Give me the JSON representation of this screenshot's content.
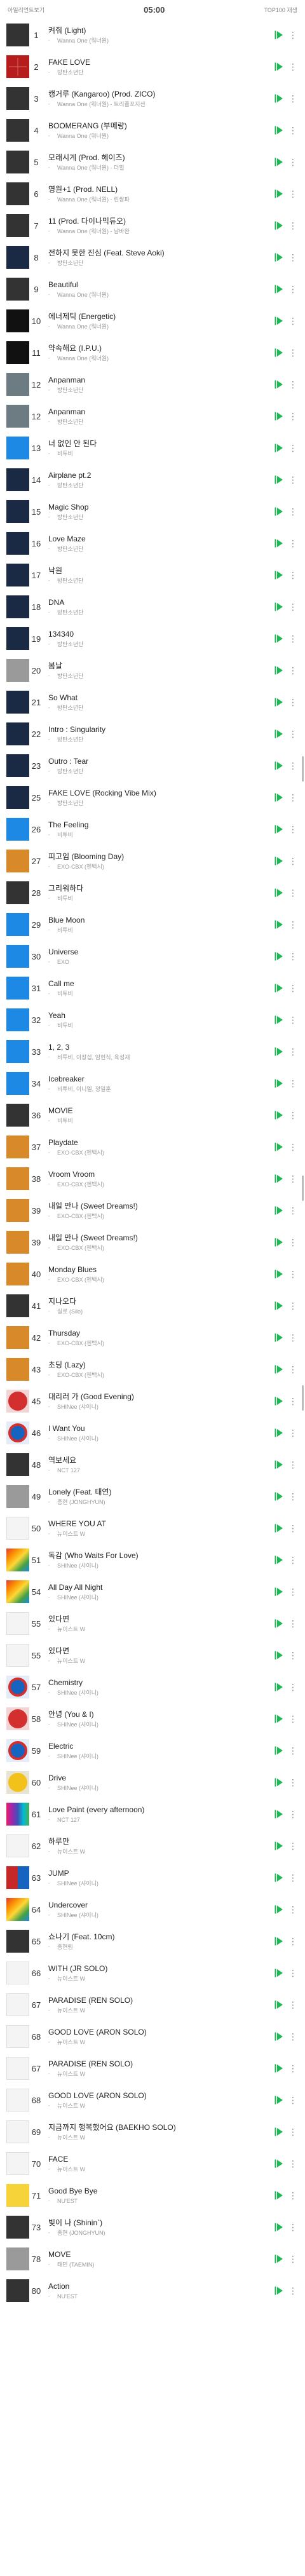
{
  "status": {
    "left": "아일리언트보기",
    "time": "05:00",
    "right": "TOP100 재생"
  },
  "colors": {
    "accent": "#1db954",
    "change": "#9ccc3c"
  },
  "icons": {
    "play": "play-icon",
    "more": "more-vertical-icon"
  },
  "songs": [
    {
      "rank": "1",
      "title": "켜줘 (Light)",
      "artist": "Wanna One (워너원)",
      "change": "-",
      "art": "dark"
    },
    {
      "rank": "2",
      "title": "FAKE LOVE",
      "artist": "방탄소년단",
      "change": "-",
      "art": "grid-red"
    },
    {
      "rank": "3",
      "title": "캥거루 (Kangaroo) (Prod. ZICO)",
      "artist": "Wanna One (워너원) - 트리플포지션",
      "change": "-",
      "art": "dark"
    },
    {
      "rank": "4",
      "title": "BOOMERANG (부메랑)",
      "artist": "Wanna One (워너원)",
      "change": "-",
      "art": "dark"
    },
    {
      "rank": "5",
      "title": "모래시계 (Prod. 헤이즈)",
      "artist": "Wanna One (워너원) - 더힐",
      "change": "-",
      "art": "dark"
    },
    {
      "rank": "6",
      "title": "영원+1 (Prod. NELL)",
      "artist": "Wanna One (워너원) - 린쌍파",
      "change": "-",
      "art": "dark"
    },
    {
      "rank": "7",
      "title": "11 (Prod. 다이나믹듀오)",
      "artist": "Wanna One (워너원) - 남바완",
      "change": "-",
      "art": "dark"
    },
    {
      "rank": "8",
      "title": "전하지 못한 진심 (Feat. Steve Aoki)",
      "artist": "방탄소년단",
      "change": "-",
      "art": "navy"
    },
    {
      "rank": "9",
      "title": "Beautiful",
      "artist": "Wanna One (워너원)",
      "change": "-",
      "art": "dark"
    },
    {
      "rank": "10",
      "title": "에너제틱 (Energetic)",
      "artist": "Wanna One (워너원)",
      "change": "-",
      "art": "black"
    },
    {
      "rank": "11",
      "title": "약속해요 (I.P.U.)",
      "artist": "Wanna One (워너원)",
      "change": "-",
      "art": "black"
    },
    {
      "rank": "12",
      "title": "Anpanman",
      "artist": "방탄소년단",
      "change": "-",
      "art": "sea"
    },
    {
      "rank": "12",
      "title": "Anpanman",
      "artist": "방탄소년단",
      "change": "-",
      "art": "sea"
    },
    {
      "rank": "13",
      "title": "너 없인 안 된다",
      "artist": "비투비",
      "change": "-",
      "art": "blue"
    },
    {
      "rank": "14",
      "title": "Airplane pt.2",
      "artist": "방탄소년단",
      "change": "-",
      "art": "navy"
    },
    {
      "rank": "15",
      "title": "Magic Shop",
      "artist": "방탄소년단",
      "change": "-",
      "art": "navy"
    },
    {
      "rank": "16",
      "title": "Love Maze",
      "artist": "방탄소년단",
      "change": "-",
      "art": "navy"
    },
    {
      "rank": "17",
      "title": "낙원",
      "artist": "방탄소년단",
      "change": "-",
      "art": "navy"
    },
    {
      "rank": "18",
      "title": "DNA",
      "artist": "방탄소년단",
      "change": "-",
      "art": "navy"
    },
    {
      "rank": "19",
      "title": "134340",
      "artist": "방탄소년단",
      "change": "-",
      "art": "navy"
    },
    {
      "rank": "20",
      "title": "봄날",
      "artist": "방탄소년단",
      "change": "-",
      "art": "gray"
    },
    {
      "rank": "21",
      "title": "So What",
      "artist": "방탄소년단",
      "change": "-",
      "art": "navy"
    },
    {
      "rank": "22",
      "title": "Intro : Singularity",
      "artist": "방탄소년단",
      "change": "-",
      "art": "navy"
    },
    {
      "rank": "23",
      "title": "Outro : Tear",
      "artist": "방탄소년단",
      "change": "-",
      "art": "navy"
    },
    {
      "rank": "25",
      "title": "FAKE LOVE (Rocking Vibe Mix)",
      "artist": "방탄소년단",
      "change": "-",
      "art": "navy"
    },
    {
      "rank": "26",
      "title": "The Feeling",
      "artist": "비투비",
      "change": "-",
      "art": "blue"
    },
    {
      "rank": "27",
      "title": "피고임 (Blooming Day)",
      "artist": "EXO-CBX (첸백시)",
      "change": "-",
      "art": "orange"
    },
    {
      "rank": "28",
      "title": "그리워하다",
      "artist": "비투비",
      "change": "-",
      "art": "dark"
    },
    {
      "rank": "29",
      "title": "Blue Moon",
      "artist": "비투비",
      "change": "-",
      "art": "blue"
    },
    {
      "rank": "30",
      "title": "Universe",
      "artist": "EXO",
      "change": "-",
      "art": "blue"
    },
    {
      "rank": "31",
      "title": "Call me",
      "artist": "비투비",
      "change": "-",
      "art": "blue"
    },
    {
      "rank": "32",
      "title": "Yeah",
      "artist": "비투비",
      "change": "-",
      "art": "blue"
    },
    {
      "rank": "33",
      "title": "1, 2, 3",
      "artist": "비투비, 이창섭, 임현식, 육성재",
      "change": "-",
      "art": "blue"
    },
    {
      "rank": "34",
      "title": "Icebreaker",
      "artist": "비투비, 이니엘, 정일훈",
      "change": "-",
      "art": "blue"
    },
    {
      "rank": "36",
      "title": "MOVIE",
      "artist": "비투비",
      "change": "-",
      "art": "dark"
    },
    {
      "rank": "37",
      "title": "Playdate",
      "artist": "EXO-CBX (첸백시)",
      "change": "-",
      "art": "orange"
    },
    {
      "rank": "38",
      "title": "Vroom Vroom",
      "artist": "EXO-CBX (첸백시)",
      "change": "-",
      "art": "orange"
    },
    {
      "rank": "39",
      "title": "내일 만나 (Sweet Dreams!)",
      "artist": "EXO-CBX (첸백시)",
      "change": "-",
      "art": "orange"
    },
    {
      "rank": "39",
      "title": "내일 만나 (Sweet Dreams!)",
      "artist": "EXO-CBX (첸백시)",
      "change": "-",
      "art": "orange"
    },
    {
      "rank": "40",
      "title": "Monday Blues",
      "artist": "EXO-CBX (첸백시)",
      "change": "-",
      "art": "orange"
    },
    {
      "rank": "41",
      "title": "지나오다",
      "artist": "실로 (Silo)",
      "change": "-",
      "art": "dark"
    },
    {
      "rank": "42",
      "title": "Thursday",
      "artist": "EXO-CBX (첸백시)",
      "change": "-",
      "art": "orange"
    },
    {
      "rank": "43",
      "title": "초딩 (Lazy)",
      "artist": "EXO-CBX (첸백시)",
      "change": "-",
      "art": "orange"
    },
    {
      "rank": "45",
      "title": "대리러 가 (Good Evening)",
      "artist": "SHINee (샤이니)",
      "change": "-",
      "art": "circle-red"
    },
    {
      "rank": "46",
      "title": "I Want You",
      "artist": "SHINee (샤이니)",
      "change": "-",
      "art": "circle-blue"
    },
    {
      "rank": "48",
      "title": "역보세요",
      "artist": "NCT 127",
      "change": "-",
      "art": "dark"
    },
    {
      "rank": "49",
      "title": "Lonely (Feat. 태연)",
      "artist": "종현 (JONGHYUN)",
      "change": "-",
      "art": "gray"
    },
    {
      "rank": "50",
      "title": "WHERE YOU AT",
      "artist": "뉴이스트 W",
      "change": "-",
      "art": "white"
    },
    {
      "rank": "51",
      "title": "독감 (Who Waits For Love)",
      "artist": "SHINee (샤이니)",
      "change": "-",
      "art": "colorful"
    },
    {
      "rank": "54",
      "title": "All Day All Night",
      "artist": "SHINee (샤이니)",
      "change": "-",
      "art": "colorful"
    },
    {
      "rank": "55",
      "title": "있다면",
      "artist": "뉴이스트 W",
      "change": "-",
      "art": "white"
    },
    {
      "rank": "55",
      "title": "있다면",
      "artist": "뉴이스트 W",
      "change": "-",
      "art": "white"
    },
    {
      "rank": "57",
      "title": "Chemistry",
      "artist": "SHINee (샤이니)",
      "change": "-",
      "art": "circle-blue"
    },
    {
      "rank": "58",
      "title": "안녕 (You & I)",
      "artist": "SHINee (샤이니)",
      "change": "-",
      "art": "circle-red"
    },
    {
      "rank": "59",
      "title": "Electric",
      "artist": "SHINee (샤이니)",
      "change": "-",
      "art": "circle-blue"
    },
    {
      "rank": "60",
      "title": "Drive",
      "artist": "SHINee (샤이니)",
      "change": "-",
      "art": "circle-yellow"
    },
    {
      "rank": "61",
      "title": "Love Paint (every afternoon)",
      "artist": "NCT 127",
      "change": "-",
      "art": "rainbow"
    },
    {
      "rank": "62",
      "title": "하루만",
      "artist": "뉴이스트 W",
      "change": "-",
      "art": "white"
    },
    {
      "rank": "63",
      "title": "JUMP",
      "artist": "SHINee (샤이니)",
      "change": "-",
      "art": "halfred"
    },
    {
      "rank": "64",
      "title": "Undercover",
      "artist": "SHINee (샤이니)",
      "change": "-",
      "art": "colorful"
    },
    {
      "rank": "65",
      "title": "쇼나기 (Feat. 10cm)",
      "artist": "종현림",
      "change": "-",
      "art": "dark"
    },
    {
      "rank": "66",
      "title": "WITH (JR SOLO)",
      "artist": "뉴이스트 W",
      "change": "-",
      "art": "white"
    },
    {
      "rank": "67",
      "title": "PARADISE (REN SOLO)",
      "artist": "뉴이스트 W",
      "change": "-",
      "art": "white"
    },
    {
      "rank": "68",
      "title": "GOOD LOVE (ARON SOLO)",
      "artist": "뉴이스트 W",
      "change": "-",
      "art": "white"
    },
    {
      "rank": "67",
      "title": "PARADISE (REN SOLO)",
      "artist": "뉴이스트 W",
      "change": "-",
      "art": "white"
    },
    {
      "rank": "68",
      "title": "GOOD LOVE (ARON SOLO)",
      "artist": "뉴이스트 W",
      "change": "-",
      "art": "white"
    },
    {
      "rank": "69",
      "title": "지금까지 행복했어요 (BAEKHO SOLO)",
      "artist": "뉴이스트 W",
      "change": "-",
      "art": "white"
    },
    {
      "rank": "70",
      "title": "FACE",
      "artist": "뉴이스트 W",
      "change": "-",
      "art": "white"
    },
    {
      "rank": "71",
      "title": "Good Bye Bye",
      "artist": "NU'EST",
      "change": "-",
      "art": "yellow-b"
    },
    {
      "rank": "73",
      "title": "빛이 나 (Shinin`)",
      "artist": "종현 (JONGHYUN)",
      "change": "-",
      "art": "dark"
    },
    {
      "rank": "78",
      "title": "MOVE",
      "artist": "태민 (TAEMIN)",
      "change": "-",
      "art": "gray"
    },
    {
      "rank": "80",
      "title": "Action",
      "artist": "NU'EST",
      "change": "-",
      "art": "dark"
    }
  ]
}
